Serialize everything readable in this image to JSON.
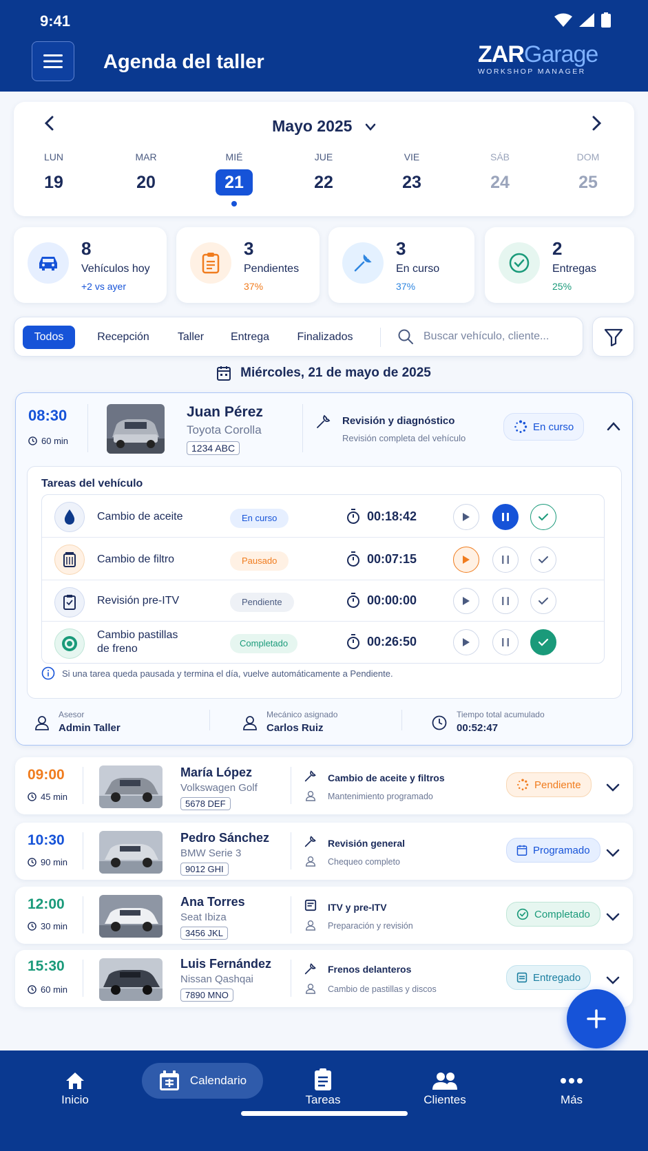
{
  "status": {
    "time": "9:41"
  },
  "header": {
    "title": "Agenda del taller",
    "logo_main_a": "ZAR",
    "logo_main_b": "Garage",
    "logo_sub": "WORKSHOP MANAGER"
  },
  "calendar": {
    "month": "Mayo 2025",
    "days": [
      {
        "name": "LUN",
        "num": "19"
      },
      {
        "name": "MAR",
        "num": "20"
      },
      {
        "name": "MIÉ",
        "num": "21"
      },
      {
        "name": "JUE",
        "num": "22"
      },
      {
        "name": "VIE",
        "num": "23"
      },
      {
        "name": "SÁB",
        "num": "24"
      },
      {
        "name": "DOM",
        "num": "25"
      }
    ]
  },
  "stats": [
    {
      "num": "8",
      "label": "Vehículos hoy",
      "sub": "+2 vs ayer",
      "color": "#1653d8",
      "icon": "car-icon"
    },
    {
      "num": "3",
      "label": "Pendientes",
      "sub": "37%",
      "color": "#f07c1e",
      "icon": "clipboard-icon"
    },
    {
      "num": "3",
      "label": "En curso",
      "sub": "37%",
      "color": "#2f86e0",
      "icon": "wrench-icon"
    },
    {
      "num": "2",
      "label": "Entregas",
      "sub": "25%",
      "color": "#1a9a7a",
      "icon": "check-circle-icon"
    }
  ],
  "filters": {
    "tabs": [
      "Todos",
      "Recepción",
      "Taller",
      "Entrega",
      "Finalizados"
    ],
    "search_placeholder": "Buscar vehículo, cliente..."
  },
  "date_heading": "Miércoles, 21 de mayo de 2025",
  "expanded": {
    "time": "08:30",
    "duration": "60 min",
    "client": "Juan Pérez",
    "car": "Toyota Corolla",
    "plate": "1234 ABC",
    "service": "Revisión y diagnóstico",
    "service_sub": "Revisión completa del vehículo",
    "status": "En curso",
    "tasks_title": "Tareas del vehículo",
    "tasks": [
      {
        "name": "Cambio de aceite",
        "name2": "",
        "state": "En curso",
        "timer": "00:18:42",
        "icon": "oil-drop-icon"
      },
      {
        "name": "Cambio de filtro",
        "name2": "",
        "state": "Pausado",
        "timer": "00:07:15",
        "icon": "filter-icon"
      },
      {
        "name": "Revisión pre-ITV",
        "name2": "",
        "state": "Pendiente",
        "timer": "00:00:00",
        "icon": "checklist-icon"
      },
      {
        "name": "Cambio pastillas",
        "name2": "de freno",
        "state": "Completado",
        "timer": "00:26:50",
        "icon": "brake-icon"
      }
    ],
    "note": "Si una tarea queda pausada y termina el día, vuelve automáticamente a Pendiente.",
    "advisor_label": "Asesor",
    "advisor": "Admin Taller",
    "mechanic_label": "Mecánico asignado",
    "mechanic": "Carlos Ruiz",
    "total_label": "Tiempo total acumulado",
    "total": "00:52:47"
  },
  "appointments": [
    {
      "time": "09:00",
      "time_color": "#f07c1e",
      "duration": "45 min",
      "client": "María López",
      "car": "Volkswagen Golf",
      "plate": "5678 DEF",
      "service": "Cambio de aceite y filtros",
      "service_sub": "Mantenimiento programado",
      "status": "Pendiente",
      "status_color": "#f07c1e",
      "status_bg": "#fff1e4"
    },
    {
      "time": "10:30",
      "time_color": "#1653d8",
      "duration": "90 min",
      "client": "Pedro Sánchez",
      "car": "BMW Serie 3",
      "plate": "9012 GHI",
      "service": "Revisión general",
      "service_sub": "Chequeo completo",
      "status": "Programado",
      "status_color": "#1653d8",
      "status_bg": "#e6efff"
    },
    {
      "time": "12:00",
      "time_color": "#1a9a7a",
      "duration": "30 min",
      "client": "Ana Torres",
      "car": "Seat Ibiza",
      "plate": "3456 JKL",
      "service": "ITV y pre-ITV",
      "service_sub": "Preparación y revisión",
      "status": "Completado",
      "status_color": "#1a9a7a",
      "status_bg": "#e6f6f0"
    },
    {
      "time": "15:30",
      "time_color": "#1a9a7a",
      "duration": "60 min",
      "client": "Luis Fernández",
      "car": "Nissan Qashqai",
      "plate": "7890 MNO",
      "service": "Frenos delanteros",
      "service_sub": "Cambio de pastillas y discos",
      "status": "Entregado",
      "status_color": "#1a7ea0",
      "status_bg": "#e4f3f8"
    }
  ],
  "nav": {
    "items": [
      "Inicio",
      "Calendario",
      "Tareas",
      "Clientes",
      "Más"
    ]
  }
}
